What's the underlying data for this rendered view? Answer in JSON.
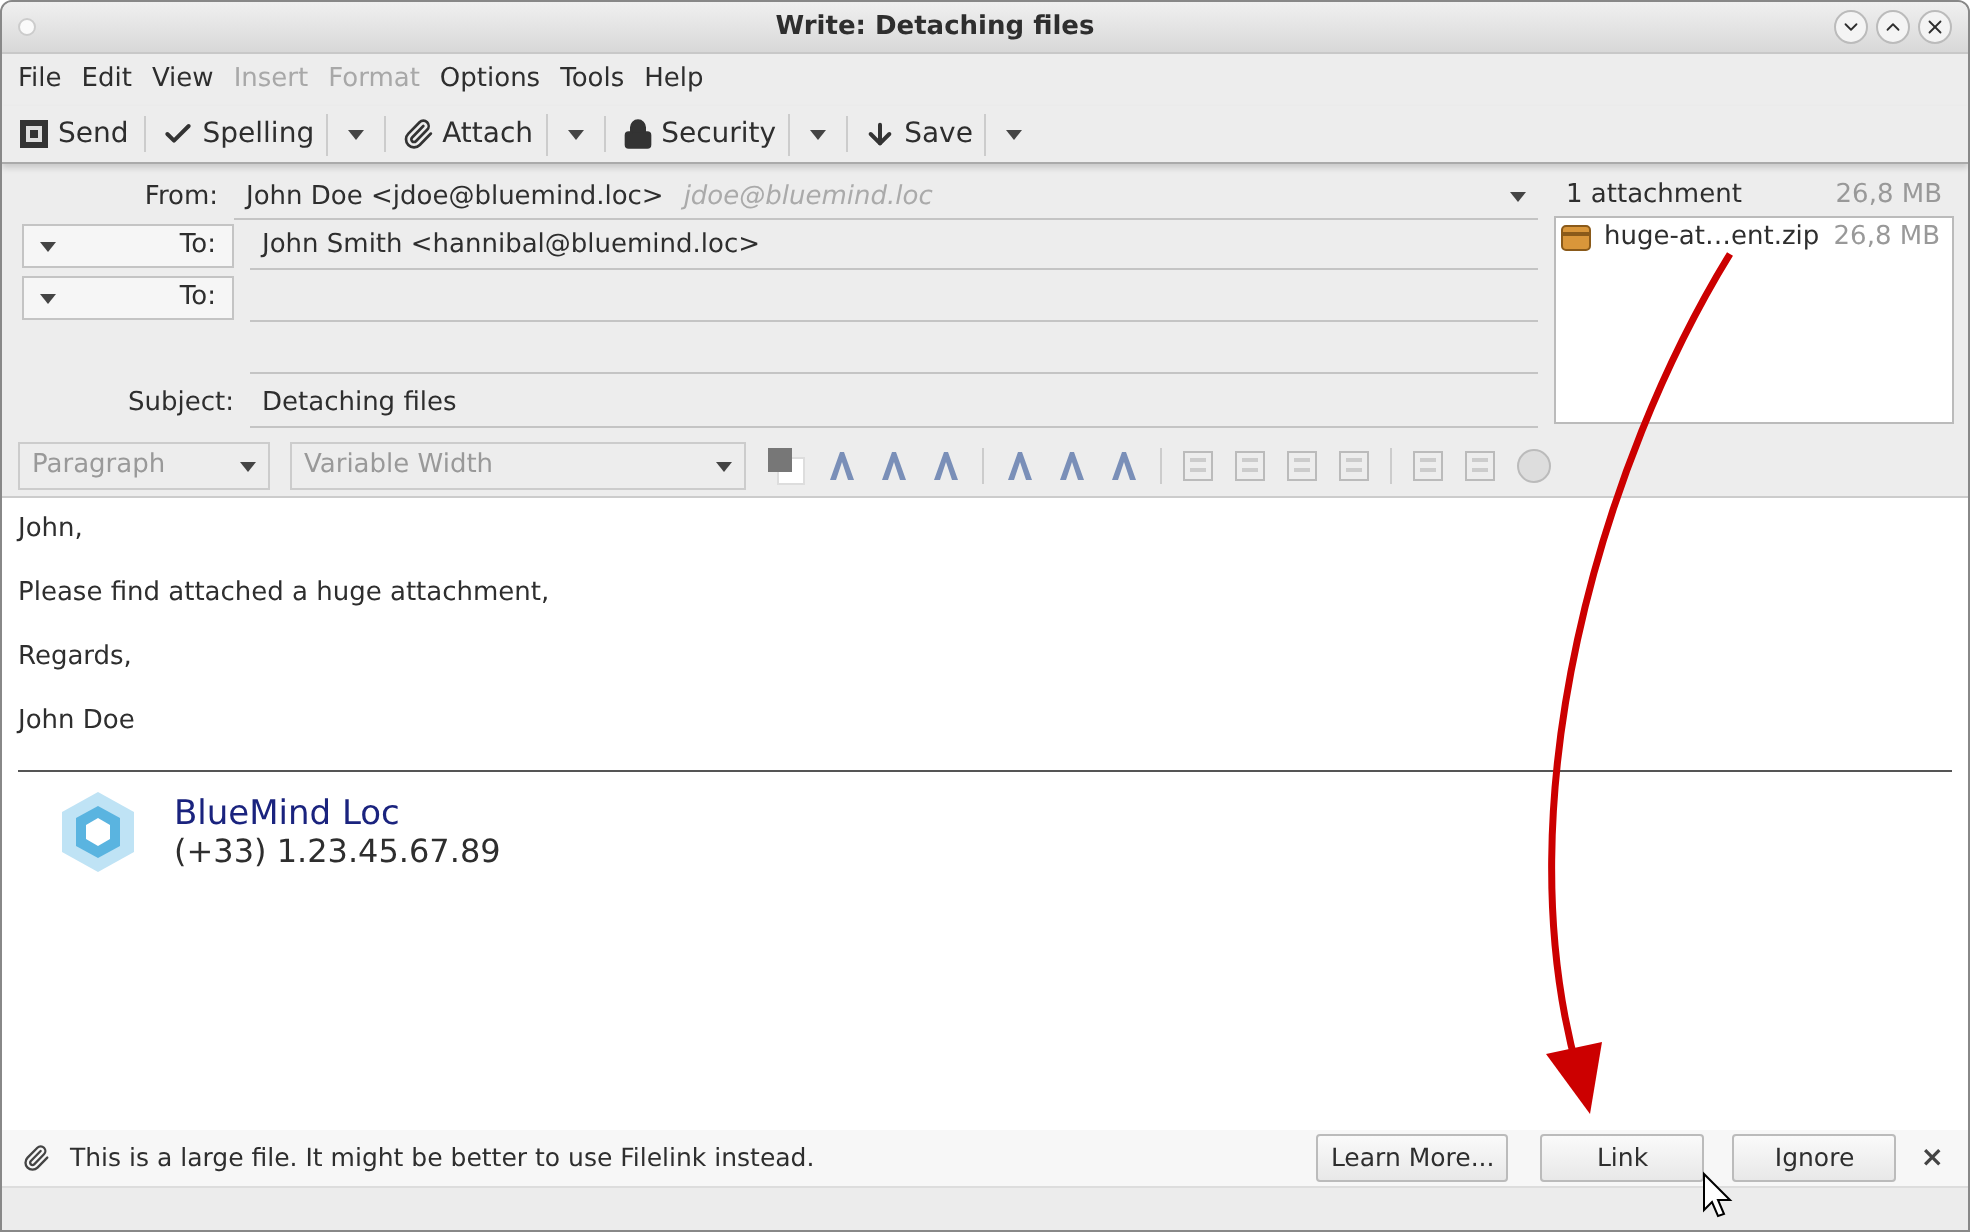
{
  "window": {
    "title": "Write: Detaching files"
  },
  "menu": [
    {
      "label": "File",
      "disabled": false
    },
    {
      "label": "Edit",
      "disabled": false
    },
    {
      "label": "View",
      "disabled": false
    },
    {
      "label": "Insert",
      "disabled": true
    },
    {
      "label": "Format",
      "disabled": true
    },
    {
      "label": "Options",
      "disabled": false
    },
    {
      "label": "Tools",
      "disabled": false
    },
    {
      "label": "Help",
      "disabled": false
    }
  ],
  "toolbar": [
    {
      "label": "Send",
      "kind": "send",
      "dropdown": false
    },
    {
      "label": "Spelling",
      "kind": "spelling",
      "dropdown": true
    },
    {
      "label": "Attach",
      "kind": "attach",
      "dropdown": true
    },
    {
      "label": "Security",
      "kind": "security",
      "dropdown": true
    },
    {
      "label": "Save",
      "kind": "save",
      "dropdown": true
    }
  ],
  "header": {
    "from_label": "From:",
    "from_value": "John Doe <jdoe@bluemind.loc>",
    "identity_hint": "jdoe@bluemind.loc",
    "recipients": [
      {
        "label": "To:",
        "value": "John Smith <hannibal@bluemind.loc>"
      },
      {
        "label": "To:"
      }
    ],
    "subject_label": "Subject:",
    "subject": "Detaching files"
  },
  "attachments": {
    "count": "1 attachment",
    "total": "26,8 MB",
    "items": [
      {
        "name": "huge-at…ent.zip",
        "size": "26,8 MB"
      }
    ]
  },
  "format_bar": {
    "paragraph": "Paragraph",
    "font": "Variable Width"
  },
  "body": {
    "lines": [
      "John,",
      "Please find attached a huge attachment,",
      "Regards,",
      "John Doe"
    ]
  },
  "signature": {
    "name": "BlueMind Loc",
    "phone": "(+33) 1.23.45.67.89"
  },
  "notification": {
    "message": "This is a large file. It might be better to use Filelink instead.",
    "buttons": [
      "Learn More...",
      "Link",
      "Ignore"
    ],
    "close": "×"
  }
}
